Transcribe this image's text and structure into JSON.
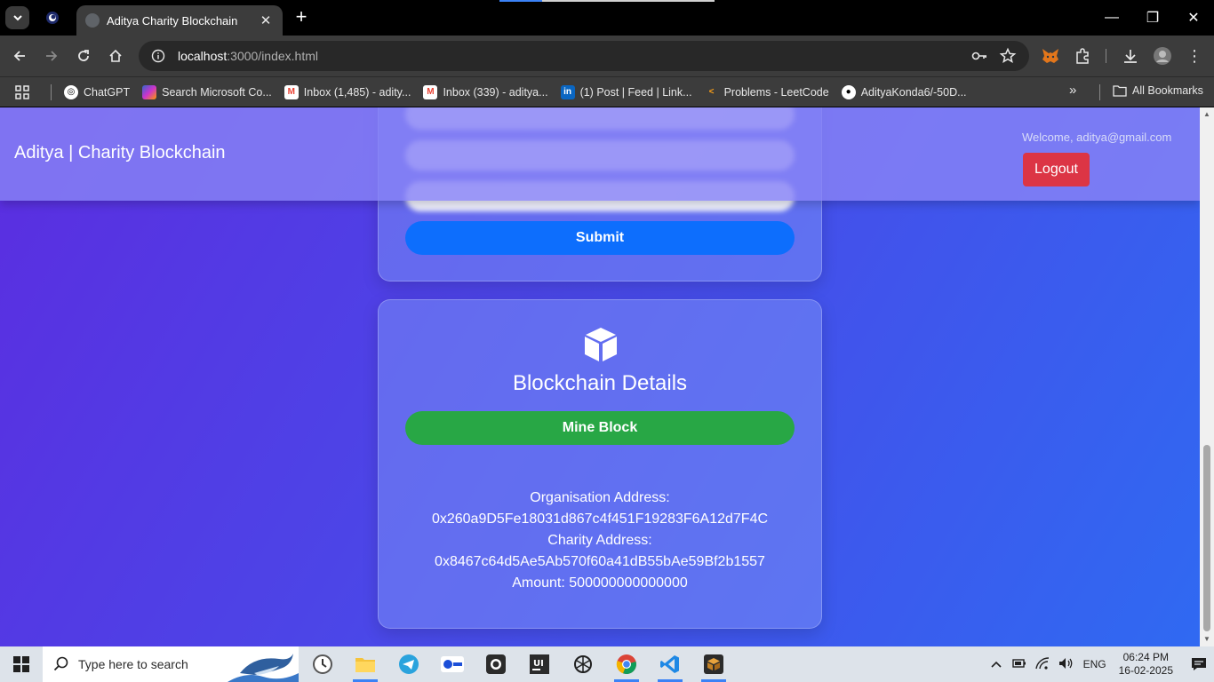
{
  "browser": {
    "tab_title": "Aditya Charity Blockchain",
    "url_host": "localhost",
    "url_path": ":3000/index.html",
    "bookmarks": [
      {
        "label": "ChatGPT"
      },
      {
        "label": "Search Microsoft Co..."
      },
      {
        "label": "Inbox (1,485) - adity..."
      },
      {
        "label": "Inbox (339) - aditya..."
      },
      {
        "label": "(1) Post | Feed | Link..."
      },
      {
        "label": "Problems - LeetCode"
      },
      {
        "label": "AdityaKonda6/-50D..."
      }
    ],
    "all_bookmarks": "All Bookmarks"
  },
  "navbar": {
    "brand": "Aditya | Charity Blockchain",
    "welcome": "Welcome, aditya@gmail.com",
    "logout": "Logout"
  },
  "form_card": {
    "submit": "Submit"
  },
  "blockchain_card": {
    "title": "Blockchain Details",
    "mine_button": "Mine Block",
    "org_label": "Organisation Address:",
    "org_address": "0x260a9D5Fe18031d867c4f451F19283F6A12d7F4C",
    "charity_label": "Charity Address:",
    "charity_address": "0x8467c64d5Ae5Ab570f60a41dB55bAe59Bf2b1557",
    "amount": "Amount: 500000000000000"
  },
  "taskbar": {
    "search_placeholder": "Type here to search",
    "language": "ENG",
    "time": "06:24 PM",
    "date": "16-02-2025"
  },
  "colors": {
    "submit": "#0d6efd",
    "mine": "#28a745",
    "logout": "#dc3545"
  }
}
